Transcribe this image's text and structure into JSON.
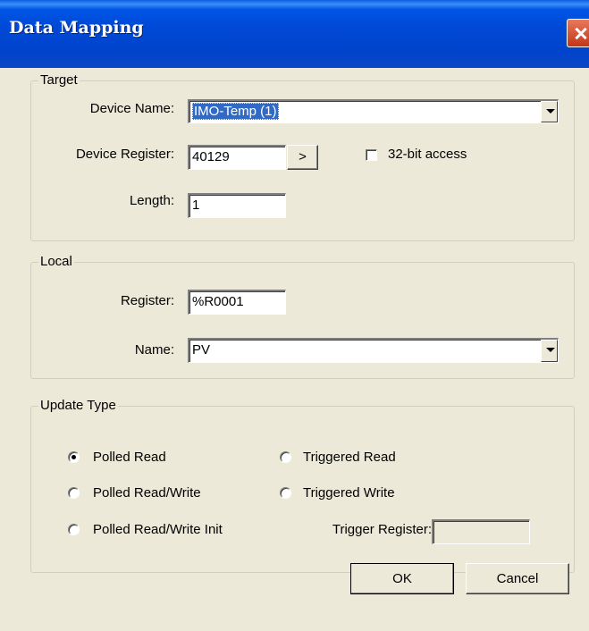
{
  "window": {
    "title": "Data Mapping"
  },
  "target": {
    "legend": "Target",
    "device_name_label": "Device Name:",
    "device_name_value": "IMO-Temp (1)",
    "device_register_label": "Device Register:",
    "device_register_value": "40129",
    "browse_button": ">",
    "access_label": "32-bit access",
    "access_checked": false,
    "length_label": "Length:",
    "length_value": "1"
  },
  "local": {
    "legend": "Local",
    "register_label": "Register:",
    "register_value": "%R0001",
    "name_label": "Name:",
    "name_value": "PV"
  },
  "update_type": {
    "legend": "Update Type",
    "options": [
      {
        "label": "Polled Read",
        "checked": true
      },
      {
        "label": "Polled Read/Write",
        "checked": false
      },
      {
        "label": "Polled Read/Write Init",
        "checked": false
      },
      {
        "label": "Triggered Read",
        "checked": false
      },
      {
        "label": "Triggered Write",
        "checked": false
      }
    ],
    "trigger_register_label": "Trigger Register:",
    "trigger_register_value": ""
  },
  "buttons": {
    "ok": "OK",
    "cancel": "Cancel"
  }
}
